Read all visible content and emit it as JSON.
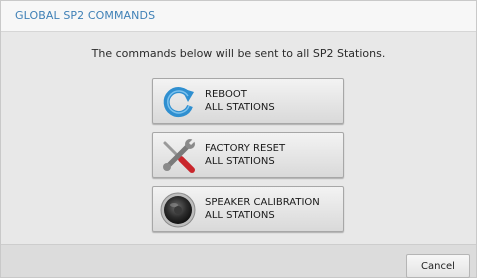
{
  "dialog": {
    "title": "GLOBAL SP2 COMMANDS",
    "message": "The commands below will be sent to all SP2 Stations."
  },
  "commands": [
    {
      "line1": "REBOOT",
      "line2": "ALL STATIONS",
      "icon": "refresh-icon"
    },
    {
      "line1": "FACTORY RESET",
      "line2": "ALL STATIONS",
      "icon": "tools-icon"
    },
    {
      "line1": "SPEAKER CALIBRATION",
      "line2": "ALL STATIONS",
      "icon": "speaker-icon"
    }
  ],
  "footer": {
    "cancel_label": "Cancel"
  },
  "colors": {
    "title": "#3f80b6",
    "refresh": "#2f8fd0",
    "tools_red": "#c9262c"
  }
}
